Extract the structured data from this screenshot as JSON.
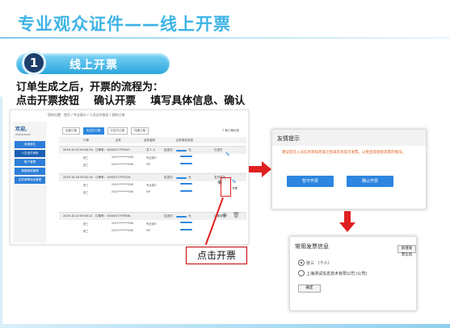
{
  "slide": {
    "title": "专业观众证件——线上开票",
    "step_number": "1",
    "step_label": "线上开票",
    "line1": "订单生成之后，开票的流程为：",
    "line2": "点击开票按钮    确认开票    填写具体信息、确认"
  },
  "screenshot": {
    "breadcrumb": "您的位置：首页 / 专业观众 / 人员证件报名 / 我的订单",
    "welcome": "欢迎,",
    "welcome_sub": "xxxxxxxxx",
    "side_items": [
      "参观报名",
      "人员证件审核",
      "账户管理",
      "邮箱更改管理",
      "证件邮寄地址管理"
    ],
    "tabs": [
      "全部订单",
      "未支付订单",
      "已支付订单",
      "作废订单"
    ],
    "count": "7 条订单记录",
    "header_cols": [
      "订单",
      "证件",
      "证件组别",
      "证件报名状态"
    ],
    "orders": [
      {
        "date": "2019.10.15 09:00:34",
        "no": "订单号：1000017797447",
        "people": "共 1 人",
        "amount": "应支付：",
        "unit": "元",
        "status": "已支付",
        "rows": [
          [
            "张三",
            "2001********008",
            "专业观众"
          ],
          [
            "张三",
            "2001********008",
            "VIP"
          ]
        ]
      },
      {
        "date": "2019.10.16 09:02:34",
        "no": "订单号：1000017797518",
        "people": "",
        "amount": "应支付：",
        "unit": "元",
        "status": "支付成功",
        "rows": [
          [
            "张三",
            "2001********008",
            "专业观众"
          ],
          [
            "张三",
            "2001********008",
            "VIP"
          ]
        ]
      },
      {
        "date": "2019.10.15 09:03:21",
        "no": "订单号：1000017797608",
        "people": "",
        "amount": "应支付：",
        "unit": "元",
        "status": "订单支付",
        "rows": [
          [
            "张三",
            "2001********008",
            "专业观众"
          ],
          [
            "张三",
            "2001********008",
            "VIP"
          ]
        ]
      }
    ],
    "invoice_label": "开票",
    "callout": "点击开票"
  },
  "dialog_confirm": {
    "title": "友情提示",
    "message": "建议您在入员信息审核完成之后再开具电子发票。以免出现退款退票的情况。",
    "cancel": "暂不开票",
    "confirm": "确认开票"
  },
  "dialog_info": {
    "title": "常用发票信息",
    "new_button": "新增发票信息",
    "option1": "张三 （个人）",
    "option2": "上海测试信息技术有限公司 (公司)",
    "ok": "确定"
  },
  "colors": {
    "title": "#3fb4e6",
    "accent": "#2d86df",
    "red": "#e02020",
    "warning": "#e25b14"
  }
}
